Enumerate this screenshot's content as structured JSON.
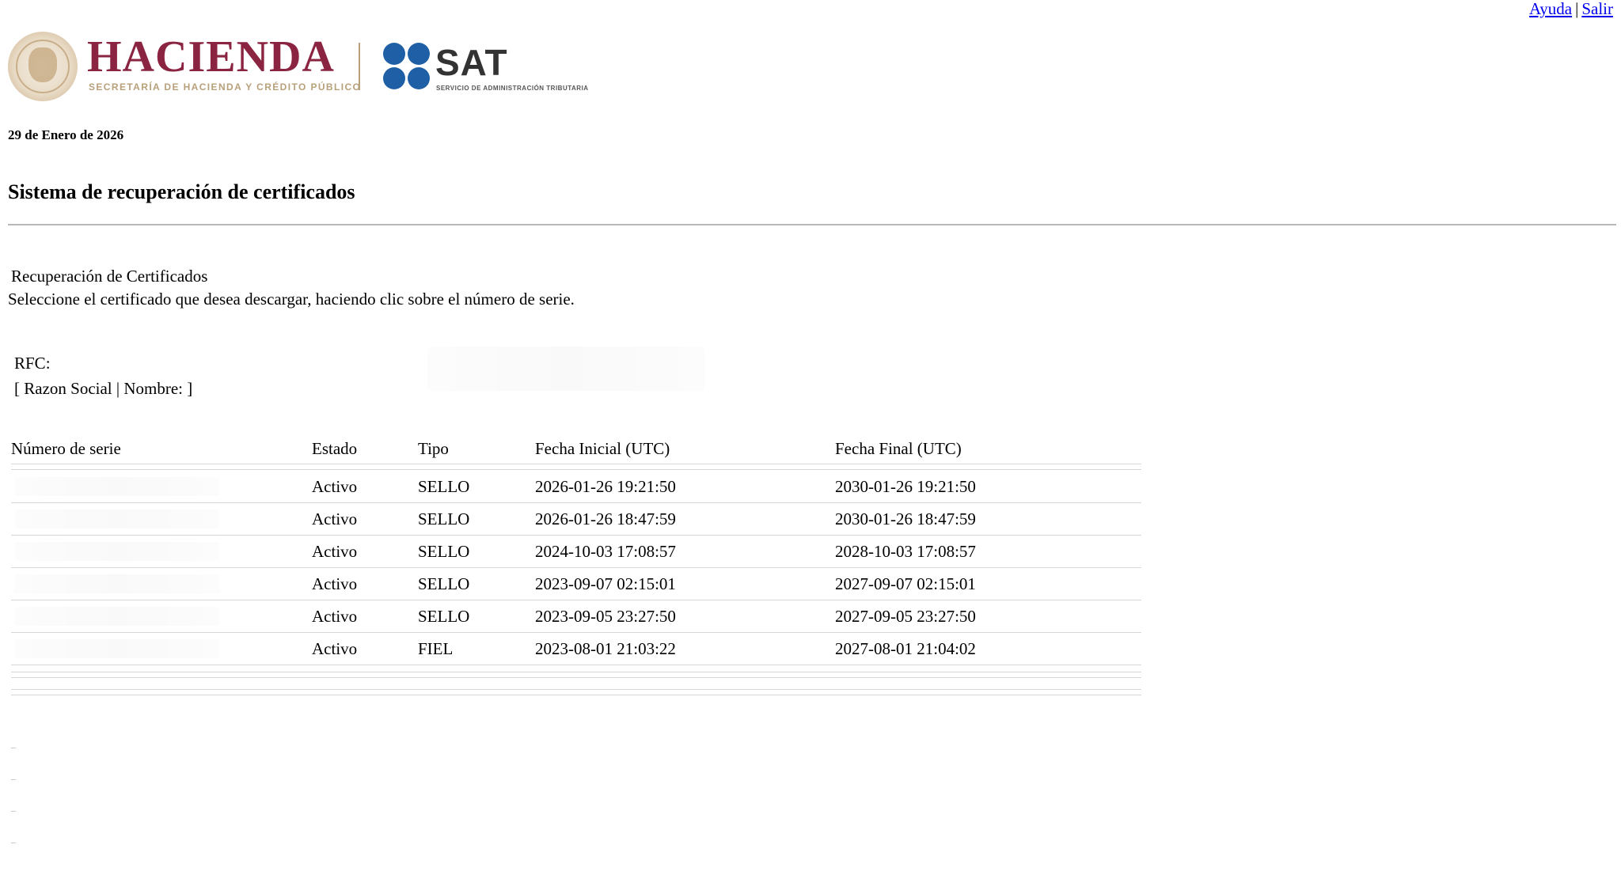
{
  "header": {
    "links": {
      "ayuda": "Ayuda",
      "separator": "|",
      "salir": "Salir"
    }
  },
  "logos": {
    "hacienda_title": "HACIENDA",
    "hacienda_subtitle": "SECRETARÍA DE HACIENDA Y CRÉDITO PÚBLICO",
    "sat_title": "SAT",
    "sat_subtitle": "SERVICIO DE ADMINISTRACIÓN TRIBUTARIA",
    "colors": {
      "hacienda": "#8a2441",
      "gold": "#b8a07a",
      "sat_blue": "#1f5fa6"
    }
  },
  "date": "29 de Enero de 2026",
  "system_title": "Sistema de recuperación de certificados",
  "section": {
    "title": "Recuperación de Certificados",
    "instructions": "Seleccione el certificado que desea descargar, haciendo clic sobre el número de serie."
  },
  "taxpayer": {
    "rfc_label": "RFC:",
    "razon_label": "[ Razon Social | Nombre: ]"
  },
  "table": {
    "headers": {
      "serie": "Número de serie",
      "estado": "Estado",
      "tipo": "Tipo",
      "fecha_inicial": "Fecha Inicial (UTC)",
      "fecha_final": "Fecha Final (UTC)"
    },
    "rows": [
      {
        "estado": "Activo",
        "tipo": "SELLO",
        "fecha_inicial": "2026-01-26 19:21:50",
        "fecha_final": "2030-01-26 19:21:50"
      },
      {
        "estado": "Activo",
        "tipo": "SELLO",
        "fecha_inicial": "2026-01-26 18:47:59",
        "fecha_final": "2030-01-26 18:47:59"
      },
      {
        "estado": "Activo",
        "tipo": "SELLO",
        "fecha_inicial": "2024-10-03 17:08:57",
        "fecha_final": "2028-10-03 17:08:57"
      },
      {
        "estado": "Activo",
        "tipo": "SELLO",
        "fecha_inicial": "2023-09-07 02:15:01",
        "fecha_final": "2027-09-07 02:15:01"
      },
      {
        "estado": "Activo",
        "tipo": "SELLO",
        "fecha_inicial": "2023-09-05 23:27:50",
        "fecha_final": "2027-09-05 23:27:50"
      },
      {
        "estado": "Activo",
        "tipo": "FIEL",
        "fecha_inicial": "2023-08-01 21:03:22",
        "fecha_final": "2027-08-01 21:04:02"
      }
    ]
  }
}
